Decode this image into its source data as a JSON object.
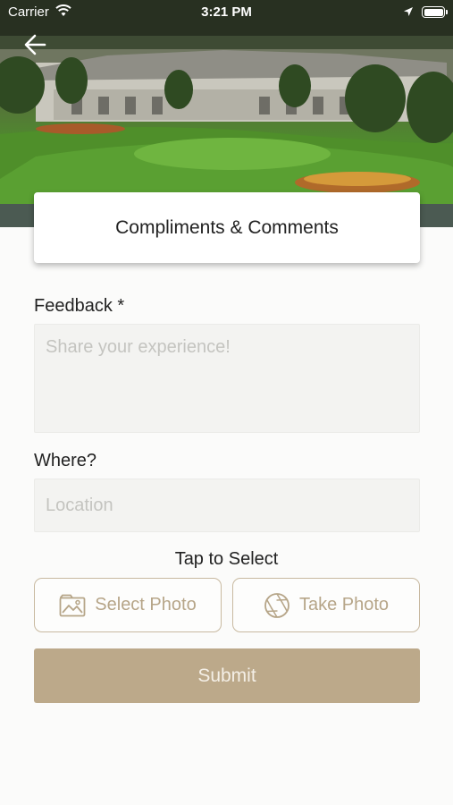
{
  "status_bar": {
    "carrier": "Carrier",
    "time": "3:21 PM"
  },
  "header": {
    "back_icon": "arrow-left-icon",
    "hero_image": "golf-course-clubhouse-photo",
    "title": "Compliments & Comments"
  },
  "form": {
    "feedback_label": "Feedback *",
    "feedback_placeholder": "Share your experience!",
    "where_label": "Where?",
    "location_placeholder": "Location",
    "tap_to_select": "Tap to Select",
    "select_photo_label": "Select Photo",
    "select_photo_icon": "image-gallery-icon",
    "take_photo_label": "Take Photo",
    "take_photo_icon": "camera-aperture-icon",
    "submit_label": "Submit"
  },
  "colors": {
    "accent": "#bca98a",
    "accent_text": "#b6a588",
    "field_bg": "#f3f3f1"
  }
}
